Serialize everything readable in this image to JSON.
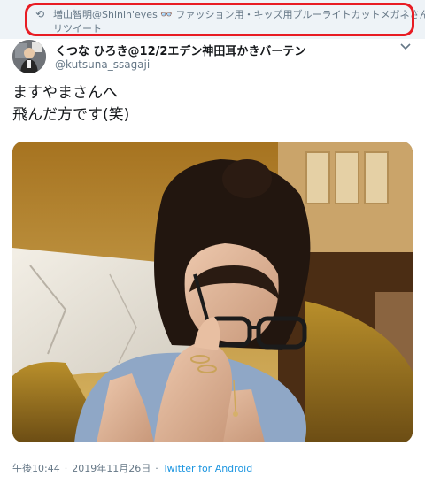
{
  "retweet": {
    "icon": "retweet-icon",
    "user": "増山智明@Shinin'eyes",
    "emoji": "👓",
    "rest": "ファッション用・キッズ用ブルーライトカットメガネさんが",
    "line2": "リツイート"
  },
  "highlight_color": "#e81c24",
  "author": {
    "display_name": "くつな ひろき@12/2エデン神田耳かきバーテン",
    "handle": "@kutsuna_ssagaji"
  },
  "tweet": {
    "line1": "ますやまさんへ",
    "line2": "飛んだ方です(笑)"
  },
  "meta": {
    "time": "午後10:44",
    "sep1": "·",
    "date": "2019年11月26日",
    "sep2": "·",
    "via": "Twitter for Android"
  },
  "colors": {
    "link": "#1b95e0",
    "secondary": "#657786",
    "text": "#14171a"
  }
}
